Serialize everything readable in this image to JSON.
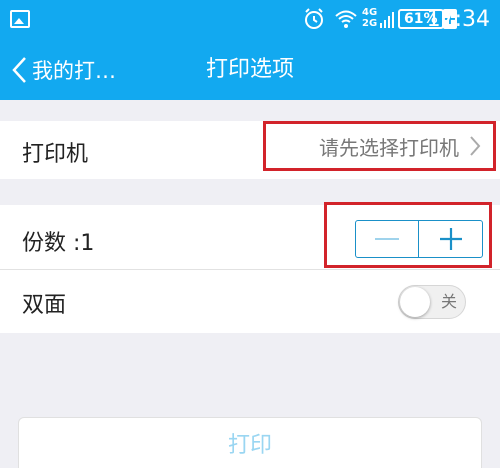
{
  "status_bar": {
    "network": "4G",
    "network2": "2G",
    "battery": "61%",
    "time": "17:34"
  },
  "app_bar": {
    "back_label": "我的打…",
    "title": "打印选项"
  },
  "printer": {
    "label": "打印机",
    "value": "请先选择打印机"
  },
  "copies": {
    "label": "份数 :1"
  },
  "duplex": {
    "label": "双面",
    "toggle_text": "关",
    "enabled": false
  },
  "print_button": {
    "label": "打印"
  },
  "colors": {
    "accent": "#12a9f0",
    "highlight_box": "#d2232a"
  }
}
